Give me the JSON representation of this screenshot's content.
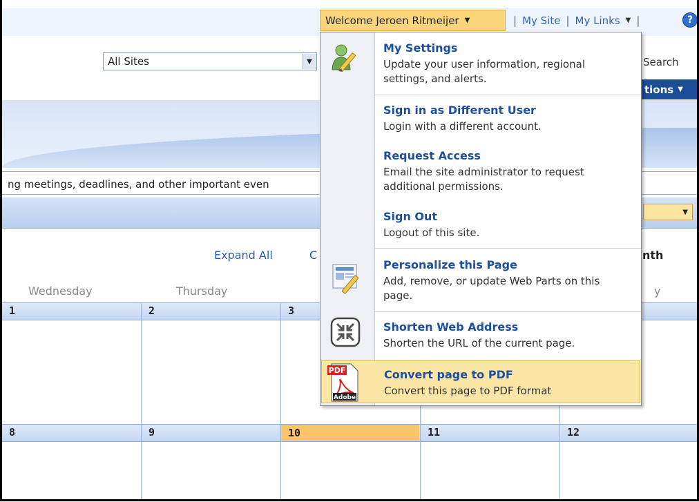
{
  "header": {
    "welcome": "Welcome Jeroen Ritmeijer",
    "my_site": "My Site",
    "my_links": "My Links",
    "help": "?"
  },
  "search": {
    "scope": "All Sites",
    "label": "Search"
  },
  "site_actions": "tions",
  "description": "ng meetings, deadlines, and other important even",
  "calendar": {
    "expand_all": "Expand All",
    "collapse_partial": "C",
    "month_partial": "nth",
    "days": [
      "Wednesday",
      "Thursday",
      "y"
    ],
    "week1": [
      "1",
      "2",
      "3"
    ],
    "week2": [
      "8",
      "9",
      "10",
      "11",
      "12"
    ]
  },
  "menu": {
    "items": [
      {
        "title": "My Settings",
        "desc": "Update your user information, regional settings, and alerts.",
        "icon": "user-settings-icon"
      },
      {
        "title": "Sign in as Different User",
        "desc": "Login with a different account."
      },
      {
        "title": "Request Access",
        "desc": "Email the site administrator to request additional permissions."
      },
      {
        "title": "Sign Out",
        "desc": "Logout of this site."
      },
      {
        "title": "Personalize this Page",
        "desc": "Add, remove, or update Web Parts on this page.",
        "icon": "personalize-page-icon"
      },
      {
        "title": "Shorten Web Address",
        "desc": "Shorten the URL of the current page.",
        "icon": "shorten-url-icon"
      },
      {
        "title": "Convert page to PDF",
        "desc": "Convert this page to PDF format",
        "icon": "pdf-icon",
        "pdf_label": "PDF",
        "adobe_label": "Adobe"
      }
    ]
  },
  "colors": {
    "accent": "#1d4f9f",
    "highlight": "#fbe6a6",
    "today": "#f9c46a"
  }
}
